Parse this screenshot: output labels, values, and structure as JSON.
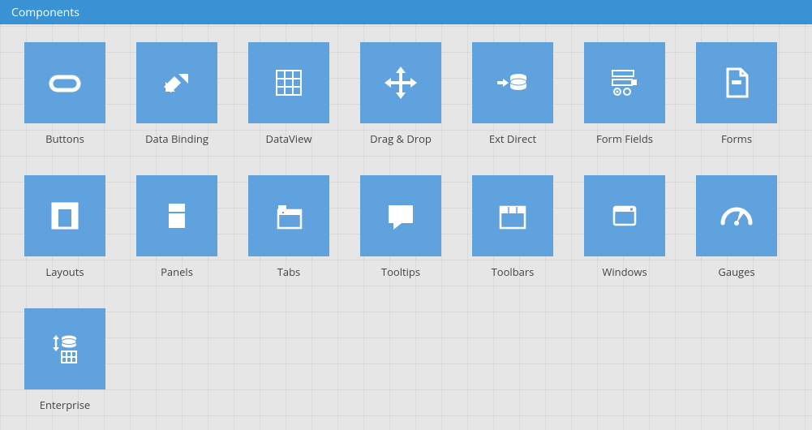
{
  "header": {
    "title": "Components"
  },
  "tiles": [
    {
      "key": "buttons",
      "label": "Buttons",
      "icon": "button-pill-icon"
    },
    {
      "key": "data-binding",
      "label": "Data Binding",
      "icon": "data-binding-icon"
    },
    {
      "key": "dataview",
      "label": "DataView",
      "icon": "dataview-grid-icon"
    },
    {
      "key": "drag-drop",
      "label": "Drag & Drop",
      "icon": "drag-drop-icon"
    },
    {
      "key": "ext-direct",
      "label": "Ext Direct",
      "icon": "ext-direct-icon"
    },
    {
      "key": "form-fields",
      "label": "Form Fields",
      "icon": "form-fields-icon"
    },
    {
      "key": "forms",
      "label": "Forms",
      "icon": "forms-file-icon"
    },
    {
      "key": "layouts",
      "label": "Layouts",
      "icon": "layouts-icon"
    },
    {
      "key": "panels",
      "label": "Panels",
      "icon": "panels-icon"
    },
    {
      "key": "tabs",
      "label": "Tabs",
      "icon": "tabs-icon"
    },
    {
      "key": "tooltips",
      "label": "Tooltips",
      "icon": "tooltip-bubble-icon"
    },
    {
      "key": "toolbars",
      "label": "Toolbars",
      "icon": "toolbars-icon"
    },
    {
      "key": "windows",
      "label": "Windows",
      "icon": "windows-icon"
    },
    {
      "key": "gauges",
      "label": "Gauges",
      "icon": "gauge-icon"
    },
    {
      "key": "enterprise",
      "label": "Enterprise",
      "icon": "enterprise-icon"
    }
  ],
  "colors": {
    "header": "#3892d4",
    "tile": "#5fa2dd",
    "icon": "#ffffff"
  }
}
